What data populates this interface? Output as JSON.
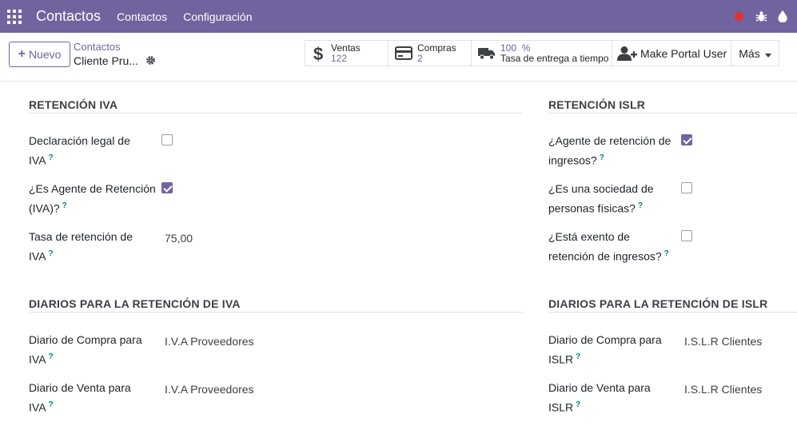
{
  "navbar": {
    "brand": "Contactos",
    "menu": [
      "Contactos",
      "Configuración"
    ],
    "record_color": "#e03131",
    "bg_color": "#71639e"
  },
  "control": {
    "new_button": "Nuevo",
    "breadcrumb_parent": "Contactos",
    "breadcrumb_current": "Cliente Pru...",
    "smart_buttons": {
      "ventas": {
        "label": "Ventas",
        "value": "122",
        "icon": "dollar-icon"
      },
      "compras": {
        "label": "Compras",
        "value": "2",
        "icon": "credit-card-icon"
      },
      "tasa": {
        "value": "100  %",
        "label": "Tasa de entrega a tiempo",
        "icon": "truck-icon"
      },
      "portal": {
        "label": "Make Portal User",
        "icon": "user-plus-icon"
      },
      "mas": {
        "label": "Más"
      }
    }
  },
  "form": {
    "iva": {
      "title": "RETENCIÓN IVA",
      "fields": [
        {
          "label1": "Declaración legal de",
          "label2": "IVA",
          "type": "checkbox",
          "checked": false
        },
        {
          "label1": "¿Es Agente de Retención",
          "label2": "(IVA)?",
          "type": "checkbox",
          "checked": true
        },
        {
          "label1": "Tasa de retención de",
          "label2": "IVA",
          "type": "value",
          "value": "75,00"
        }
      ]
    },
    "islr": {
      "title": "RETENCIÓN ISLR",
      "fields": [
        {
          "label1": "¿Agente de retención de",
          "label2": "ingresos?",
          "type": "checkbox",
          "checked": true
        },
        {
          "label1": "¿Es una sociedad de",
          "label2": "personas físicas?",
          "type": "checkbox",
          "checked": false
        },
        {
          "label1": "¿Está exento de",
          "label2": "retención de ingresos?",
          "type": "checkbox",
          "checked": false
        }
      ]
    },
    "diarios_iva": {
      "title": "DIARIOS PARA LA RETENCIÓN DE IVA",
      "fields": [
        {
          "label1": "Diario de Compra para",
          "label2": "IVA",
          "value": "I.V.A Proveedores"
        },
        {
          "label1": "Diario de Venta para",
          "label2": "IVA",
          "value": "I.V.A Proveedores"
        }
      ]
    },
    "diarios_islr": {
      "title": "DIARIOS PARA LA RETENCIÓN DE ISLR",
      "fields": [
        {
          "label1": "Diario de Compra para",
          "label2": "ISLR",
          "value": "I.S.L.R Clientes"
        },
        {
          "label1": "Diario de Venta para",
          "label2": "ISLR",
          "value": "I.S.L.R Clientes"
        }
      ]
    },
    "help_mark": "?"
  }
}
